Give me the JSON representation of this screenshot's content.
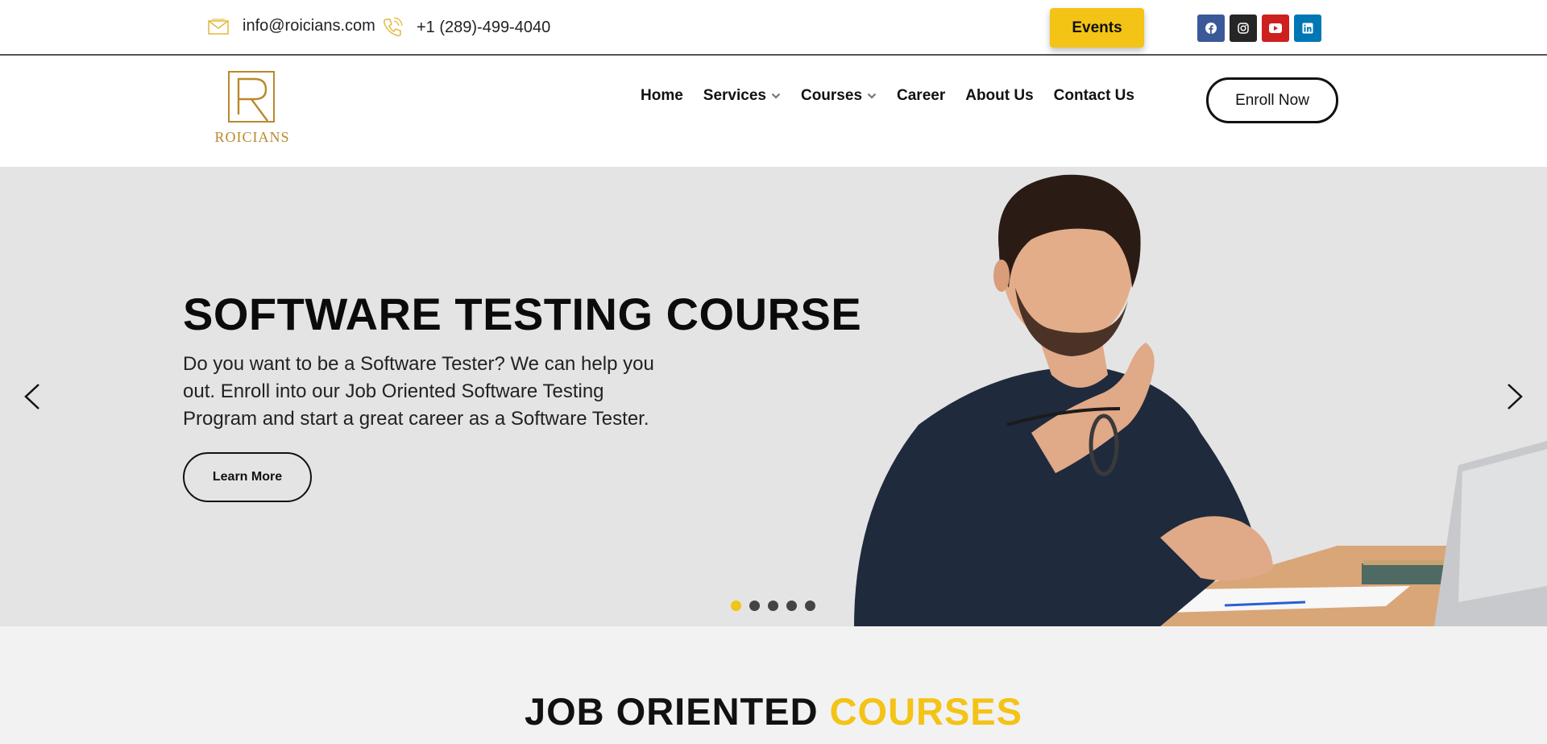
{
  "topbar": {
    "email": "info@roicians.com",
    "phone": "+1 (289)-499-4040",
    "events_label": "Events",
    "socials": [
      {
        "icon": "facebook-icon",
        "color": "#3b5998"
      },
      {
        "icon": "instagram-icon",
        "color": "#262626"
      },
      {
        "icon": "youtube-icon",
        "color": "#cd201f"
      },
      {
        "icon": "linkedin-icon",
        "color": "#0077b5"
      }
    ]
  },
  "header": {
    "logo_text": "ROICIANS",
    "nav": [
      {
        "label": "Home"
      },
      {
        "label": "Services"
      },
      {
        "label": "Courses"
      },
      {
        "label": "Career"
      },
      {
        "label": "About Us"
      },
      {
        "label": "Contact Us"
      }
    ],
    "enroll_label": "Enroll Now"
  },
  "hero": {
    "title": "SOFTWARE TESTING COURSE",
    "description": "Do you want to be a Software Tester? We can help you out. Enroll into our Job Oriented Software Testing Program and start a great career as a Software Tester.",
    "button_label": "Learn More",
    "slides_total": 5,
    "active_slide": 1
  },
  "section": {
    "title_main": "JOB ORIENTED",
    "title_accent": "COURSES"
  },
  "colors": {
    "accent": "#f3c316",
    "logo_gold": "#b9892e",
    "hero_bg": "#e4e4e4",
    "section_bg": "#f2f2f2"
  }
}
